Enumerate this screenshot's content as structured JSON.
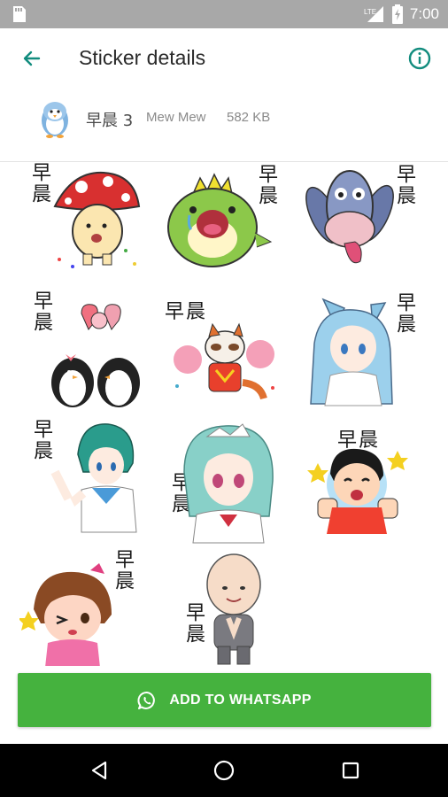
{
  "status_bar": {
    "time": "7:00",
    "network_label": "LTE",
    "icons": [
      "notification-icon",
      "lte-signal-icon",
      "battery-charging-icon"
    ]
  },
  "app_bar": {
    "title": "Sticker details",
    "icons": [
      "back-arrow-icon",
      "info-icon"
    ],
    "accent_color": "#128c7e"
  },
  "pack": {
    "name": "早晨 3",
    "publisher": "Mew Mew",
    "size": "582 KB",
    "icon": "penguin-tray-icon"
  },
  "stickers": [
    {
      "label": "早晨",
      "character": "mushroom-boy"
    },
    {
      "label": "早晨",
      "character": "green-dinosaur"
    },
    {
      "label": "早晨",
      "character": "blue-donkey"
    },
    {
      "label": "早晨",
      "character": "penguin-couple"
    },
    {
      "label": "早晨",
      "character": "raccoon-cheerleader"
    },
    {
      "label": "早晨",
      "character": "blue-cat-girl"
    },
    {
      "label": "早晨",
      "character": "sailor-mercury"
    },
    {
      "label": "早晨",
      "character": "teal-hair-girl"
    },
    {
      "label": "早晨",
      "character": "boy-thumbs-up"
    },
    {
      "label": "早晨",
      "character": "winking-girl"
    },
    {
      "label": "早晨",
      "character": "bald-monk"
    }
  ],
  "add_button": {
    "label": "ADD TO WHATSAPP",
    "icon": "whatsapp-icon",
    "color": "#45b23e"
  },
  "nav_bar": {
    "icons": [
      "back-triangle-icon",
      "home-circle-icon",
      "recents-square-icon"
    ]
  }
}
